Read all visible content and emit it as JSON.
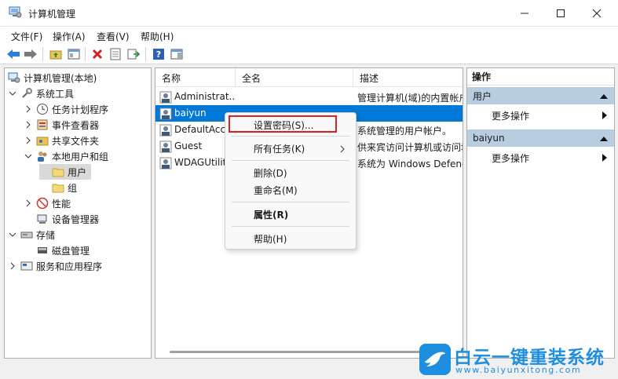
{
  "window": {
    "title": "计算机管理"
  },
  "menu": [
    "文件(F)",
    "操作(A)",
    "查看(V)",
    "帮助(H)"
  ],
  "tree": {
    "root": "计算机管理(本地)",
    "system_tools": "系统工具",
    "task_scheduler": "任务计划程序",
    "event_viewer": "事件查看器",
    "shared_folders": "共享文件夹",
    "local_users_groups": "本地用户和组",
    "users": "用户",
    "groups": "组",
    "performance": "性能",
    "device_manager": "设备管理器",
    "storage": "存储",
    "disk_management": "磁盘管理",
    "services_apps": "服务和应用程序"
  },
  "list": {
    "columns": [
      "名称",
      "全名",
      "描述"
    ],
    "rows": [
      {
        "name": "Administrat...",
        "fullname": "",
        "description": "管理计算机(域)的内置帐户"
      },
      {
        "name": "baiyun",
        "fullname": "",
        "description": ""
      },
      {
        "name": "DefaultAcc...",
        "fullname": "",
        "description": "系统管理的用户帐户。"
      },
      {
        "name": "Guest",
        "fullname": "",
        "description": "供来宾访问计算机或访问域"
      },
      {
        "name": "WDAGUtilit...",
        "fullname": "",
        "description": "系统为 Windows Defender"
      }
    ]
  },
  "context_menu": {
    "set_password": "设置密码(S)...",
    "all_tasks": "所有任务(K)",
    "delete": "删除(D)",
    "rename": "重命名(M)",
    "properties": "属性(R)",
    "help": "帮助(H)"
  },
  "actions": {
    "title": "操作",
    "section1": "用户",
    "section1_more": "更多操作",
    "section2": "baiyun",
    "section2_more": "更多操作"
  },
  "watermark": {
    "title": "白云一键重装系统",
    "url": "www.baiyunxitong.com"
  },
  "colors": {
    "selection": "#0078d7",
    "action_section": "#b8cde0",
    "highlight_box": "#e02020",
    "watermark": "#1e8ee0"
  }
}
